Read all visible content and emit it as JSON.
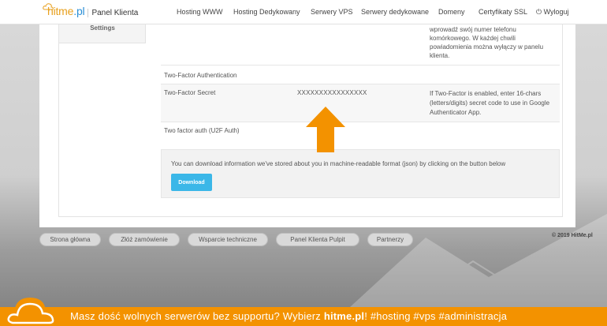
{
  "header": {
    "logo_word_a": "hitme",
    "logo_word_b": ".pl",
    "logo_sub": "Panel Klienta",
    "nav": [
      "Hosting WWW",
      "Hosting Dedykowany",
      "Serwery VPS",
      "Serwery dedykowane",
      "Domeny",
      "Certyfikaty SSL",
      "Wyloguj"
    ]
  },
  "sidebar": {
    "label": "Settings"
  },
  "settings": {
    "phone_note": "wprowadź swój numer telefonu komórkowego. W każdej chwili powiadomienia można wyłączy w panelu klienta.",
    "tfa_title": "Two-Factor Authentication",
    "secret_label": "Two-Factor Secret",
    "secret_value": "XXXXXXXXXXXXXXXX",
    "secret_help": "If Two-Factor is enabled, enter 16-chars (letters/digits) secret code to use in Google Authenticator App.",
    "u2f_label": "Two factor auth (U2F Auth)"
  },
  "download": {
    "text": "You can download information we've stored about you in machine-readable format (json) by clicking on the button below",
    "button": "Download"
  },
  "footer": {
    "links": [
      "Strona główna",
      "Złóż zamówienie",
      "Wsparcie techniczne",
      "Panel Klienta Pulpit",
      "Partnerzy"
    ],
    "copyright": "© 2019 HitMe.pl"
  },
  "banner": {
    "text_a": "Masz dość wolnych serwerów bez supportu? Wybierz ",
    "brand": "hitme.pl",
    "text_b": "!   #hosting #vps #administracja"
  },
  "colors": {
    "accent": "#f39200",
    "button": "#3bb7e8",
    "logo_orange": "#e8a01e",
    "logo_blue": "#2a8fd6"
  }
}
